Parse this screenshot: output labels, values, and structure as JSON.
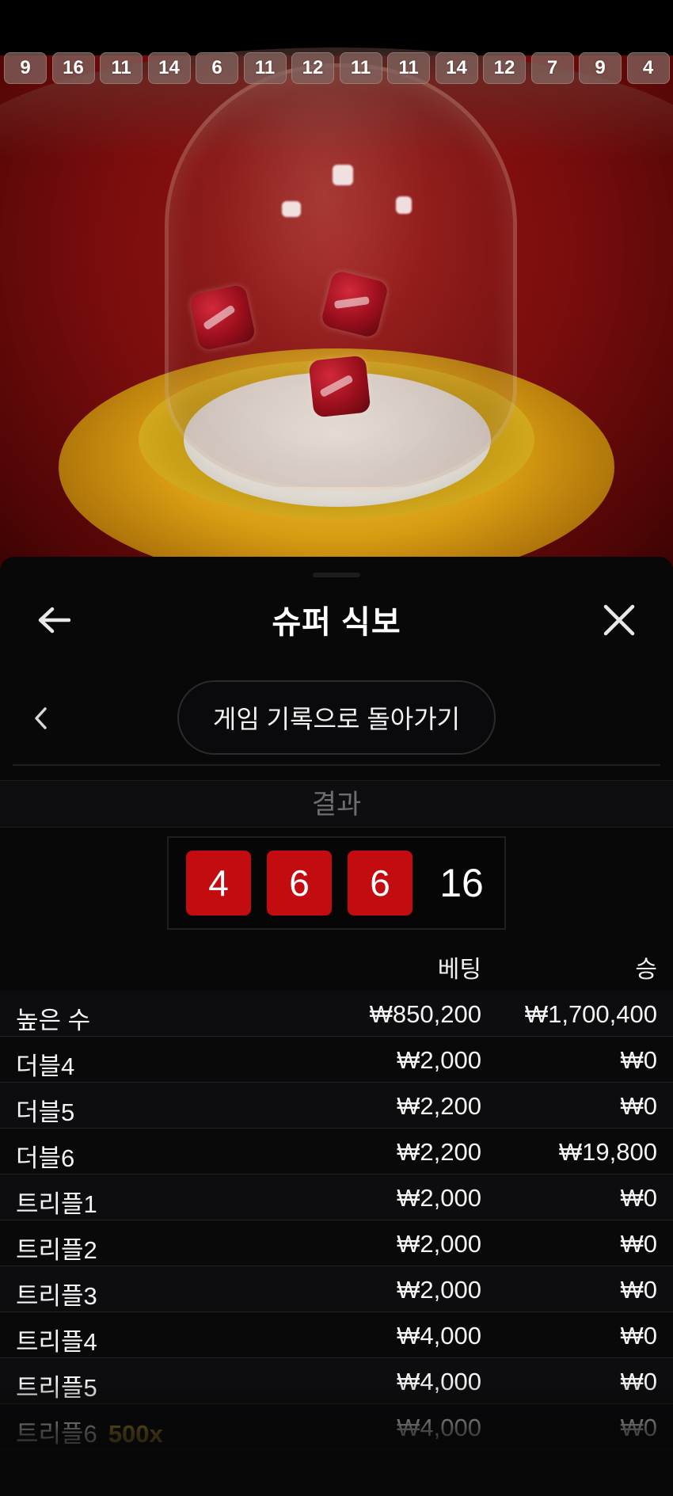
{
  "history": [
    "9",
    "16",
    "11",
    "14",
    "6",
    "11",
    "12",
    "11",
    "11",
    "14",
    "12",
    "7",
    "9",
    "4"
  ],
  "sheet": {
    "title": "슈퍼 식보",
    "back_to_history_label": "게임 기록으로 돌아가기",
    "result_label": "결과"
  },
  "result": {
    "dice": [
      "4",
      "6",
      "6"
    ],
    "total": "16",
    "die_color": "#c20c10"
  },
  "table": {
    "headers": {
      "bet": "베팅",
      "win": "승"
    },
    "rows": [
      {
        "name": "높은 수",
        "bet": "₩850,200",
        "win": "₩1,700,400"
      },
      {
        "name": "더블4",
        "bet": "₩2,000",
        "win": "₩0"
      },
      {
        "name": "더블5",
        "bet": "₩2,200",
        "win": "₩0"
      },
      {
        "name": "더블6",
        "bet": "₩2,200",
        "win": "₩19,800"
      },
      {
        "name": "트리플1",
        "bet": "₩2,000",
        "win": "₩0"
      },
      {
        "name": "트리플2",
        "bet": "₩2,000",
        "win": "₩0"
      },
      {
        "name": "트리플3",
        "bet": "₩2,000",
        "win": "₩0"
      },
      {
        "name": "트리플4",
        "bet": "₩4,000",
        "win": "₩0"
      },
      {
        "name": "트리플5",
        "bet": "₩4,000",
        "win": "₩0"
      },
      {
        "name": "트리플6",
        "multiplier": "500x",
        "bet": "₩4,000",
        "win": "₩0"
      }
    ]
  },
  "colors": {
    "multiplier": "#c5a21f",
    "sheet_bg": "#080809"
  },
  "icons": {
    "back": "arrow-left-icon",
    "close": "close-icon",
    "prev": "chevron-left-icon"
  }
}
